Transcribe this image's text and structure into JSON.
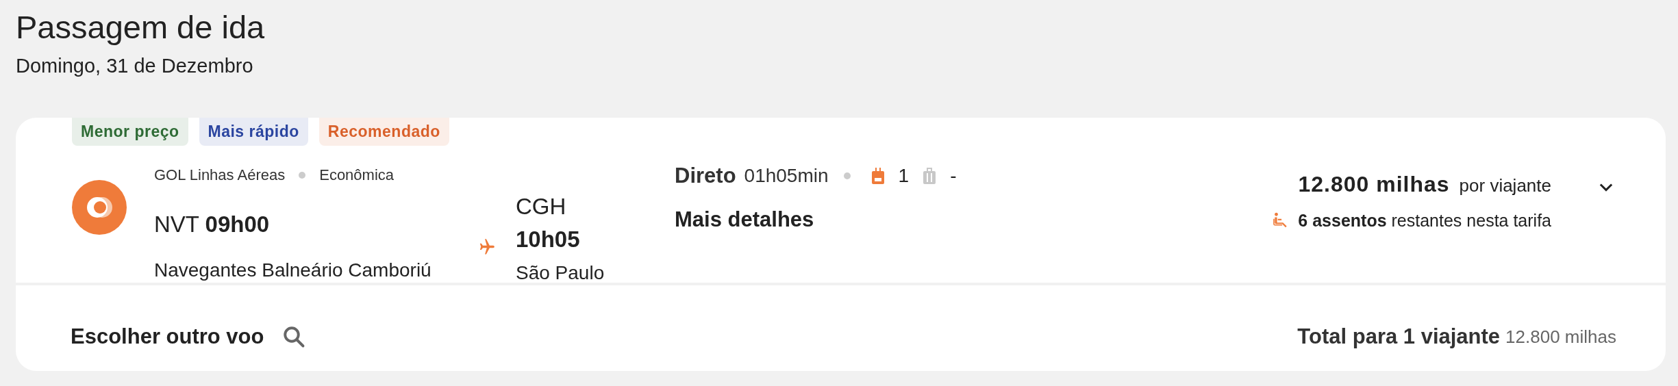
{
  "header": {
    "title": "Passagem de ida",
    "date": "Domingo, 31 de Dezembro"
  },
  "flight": {
    "tags": [
      {
        "label": "Menor preço",
        "color": "#2e6b35"
      },
      {
        "label": "Mais rápido",
        "color": "#2b45a0"
      },
      {
        "label": "Recomendado",
        "color": "#d9602a"
      }
    ],
    "airline": "GOL Linhas Aéreas",
    "cabin": "Econômica",
    "origin": {
      "code": "NVT",
      "time": "09h00",
      "city": "Navegantes Balneário Camboriú"
    },
    "destination": {
      "code": "CGH",
      "time": "10h05",
      "city": "São Paulo"
    },
    "stops": "Direto",
    "duration": "01h05min",
    "baggage": [
      {
        "kind": "backpack",
        "count": "1",
        "included": true
      },
      {
        "kind": "suitcase",
        "count": "-",
        "included": false
      }
    ],
    "details_link": "Mais detalhes",
    "price": "12.800 milhas",
    "price_unit": "por viajante",
    "seats": "**6 assentos** restantes nesta tarifa",
    "expanded": false
  },
  "footer": {
    "choose_other": "Escolher outro voo",
    "total_label": "Total para 1 viajante",
    "total_value": "12.800 milhas"
  }
}
